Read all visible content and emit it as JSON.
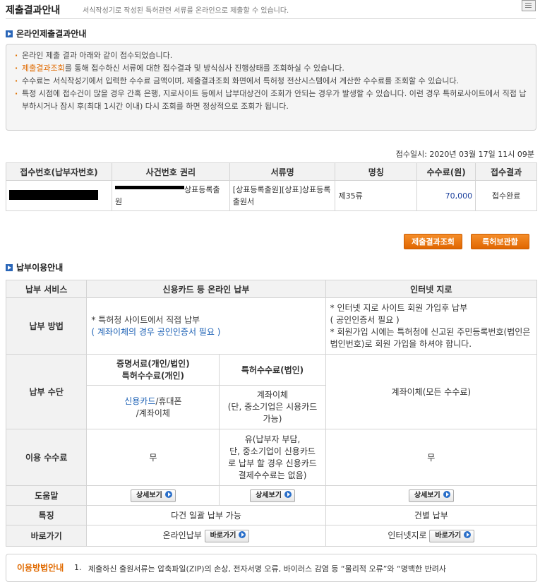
{
  "header": {
    "title": "제출결과안내",
    "subtitle": "서식작성기로 작성된 특허관련 서류를 온라인으로 제출할 수 있습니다."
  },
  "online_section": {
    "title": "온라인제출결과안내"
  },
  "notice": {
    "item1": "온라인 제출 결과 아래와 같이 접수되었습니다.",
    "item2_link": "제출결과조회",
    "item2_rest": "를 통해 접수하신 서류에 대한 접수결과 및 방식심사 진행상태를 조회하실 수 있습니다.",
    "item3": "수수료는 서식작성기에서 입력한 수수료 금액이며, 제출결과조회 화면에서 특허청 전산시스템에서 계산한 수수료를 조회할 수 있습니다.",
    "item4": "특정 시점에 접수건이 많을 경우 간혹 은행, 지로사이트 등에서 납부대상건이 조회가 안되는 경우가 발생할 수 있습니다. 이런 경우 특허로사이트에서 직접 납부하시거나 잠시 후(최대 1시간 이내) 다시 조회를 하면 정상적으로 조회가 됩니다."
  },
  "receipt": {
    "date_text": "접수일시: 2020년 03월 17일 11시 09분",
    "headers": [
      "접수번호(납부자번호)",
      "사건번호 권리",
      "서류명",
      "명칭",
      "수수료(원)",
      "접수결과"
    ],
    "row": {
      "case_right": "상표등록출원",
      "document": "[상표등록출원][상표]상표등록출원서",
      "name": "제35류",
      "fee": "70,000",
      "result": "접수완료"
    }
  },
  "buttons": {
    "submission_lookup": "제출결과조회",
    "patent_storage": "특허보관함"
  },
  "payment_section": {
    "title": "납부이용안내"
  },
  "payment": {
    "col_service": "납부 서비스",
    "col_online": "신용카드 등 온라인 납부",
    "col_internet": "인터넷 지로",
    "method_label": "납부 방법",
    "method_online_1": "* 특허청 사이트에서 직접 납부",
    "method_online_2": "( 계좌이체의 경우 공인인증서 필요 )",
    "method_internet_1": "* 인터넷 지로 사이트 회원 가입후 납부",
    "method_internet_2": "( 공인인증서 필요 )",
    "method_internet_3": "* 회원가입 시에는 특허청에 신고된 주민등록번호(법인은 법인번호)로 회원 가입을 하셔야 합니다.",
    "means_label": "납부 수단",
    "means_cert_header_1": "증명서료(개인/법인)",
    "means_cert_header_2": "특허수수료(개인)",
    "means_corp_header": "특허수수료(법인)",
    "means_cert_value_1": "신용카드",
    "means_cert_value_2": "/휴대폰",
    "means_cert_value_3": "/계좌이체",
    "means_corp_value_1": "계좌이체",
    "means_corp_value_2": "(단, 중소기업은 시용카드",
    "means_corp_value_3": "가능)",
    "means_internet": "계좌이체(모든 수수료)",
    "fee_label": "이용 수수료",
    "fee_cert": "무",
    "fee_corp_1": "유(납부자 부담,",
    "fee_corp_2": "단, 중소기업이 신용카드",
    "fee_corp_3": "로 납부 할 경우 신용카드",
    "fee_corp_4": "결제수수료는 없음)",
    "fee_internet": "무",
    "help_label": "도움말",
    "detail_button": "상세보기",
    "feature_label": "특징",
    "feature_online": "다건 일괄 납부 가능",
    "feature_internet": "건별 납부",
    "shortcut_label": "바로가기",
    "shortcut_online": "온라인납부",
    "shortcut_internet": "인터넷지로",
    "shortcut_button": "바로가기"
  },
  "usage": {
    "title": "이용방법안내",
    "num": "1.",
    "text": "제출하신 출원서류는 압축파일(ZIP)의 손상, 전자서명 오류, 바이러스 감염 등 “물리적 오류”와 “명백한 반려사"
  }
}
